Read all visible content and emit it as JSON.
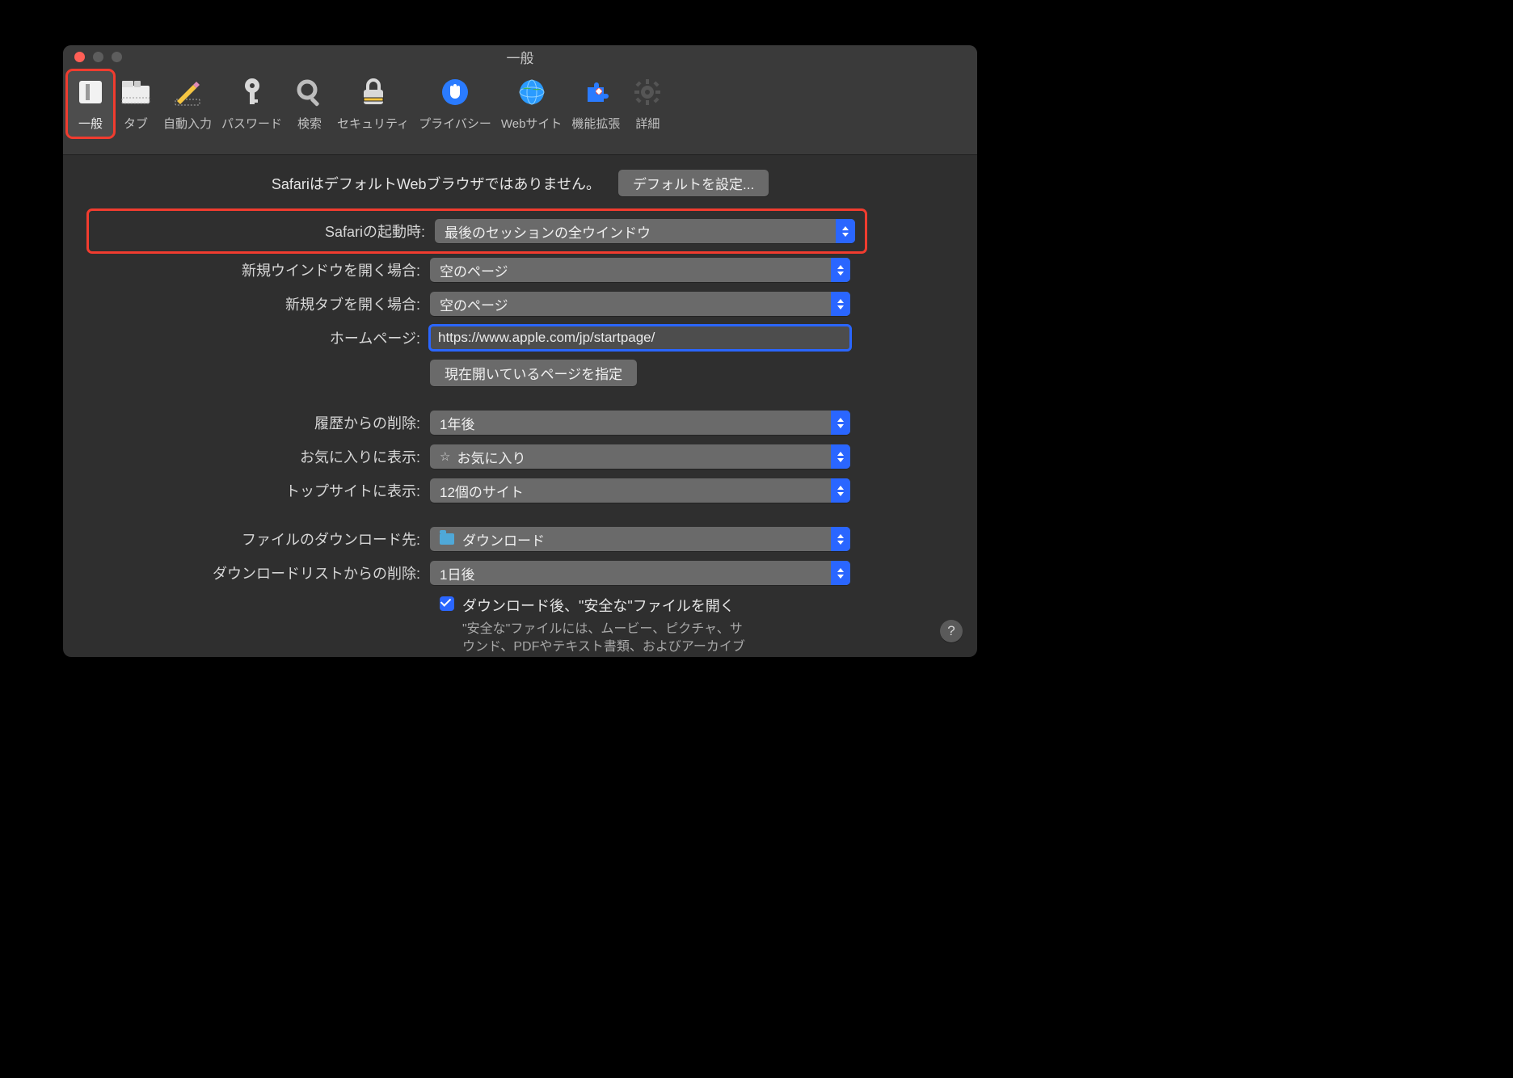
{
  "window": {
    "title": "一般"
  },
  "toolbar": {
    "items": [
      {
        "label": "一般",
        "icon": "switch"
      },
      {
        "label": "タブ",
        "icon": "tabs"
      },
      {
        "label": "自動入力",
        "icon": "pencil"
      },
      {
        "label": "パスワード",
        "icon": "key"
      },
      {
        "label": "検索",
        "icon": "magnify"
      },
      {
        "label": "セキュリティ",
        "icon": "lock"
      },
      {
        "label": "プライバシー",
        "icon": "hand"
      },
      {
        "label": "Webサイト",
        "icon": "globe"
      },
      {
        "label": "機能拡張",
        "icon": "puzzle"
      },
      {
        "label": "詳細",
        "icon": "gear"
      }
    ]
  },
  "banner": {
    "text": "SafariはデフォルトWebブラウザではありません。",
    "button": "デフォルトを設定..."
  },
  "form": {
    "startup": {
      "label": "Safariの起動時:",
      "value": "最後のセッションの全ウインドウ"
    },
    "newWindow": {
      "label": "新規ウインドウを開く場合:",
      "value": "空のページ"
    },
    "newTab": {
      "label": "新規タブを開く場合:",
      "value": "空のページ"
    },
    "homepage": {
      "label": "ホームページ:",
      "value": "https://www.apple.com/jp/startpage/"
    },
    "setCurrent": {
      "button": "現在開いているページを指定"
    },
    "historyDelete": {
      "label": "履歴からの削除:",
      "value": "1年後"
    },
    "favorites": {
      "label": "お気に入りに表示:",
      "value": "お気に入り"
    },
    "topSites": {
      "label": "トップサイトに表示:",
      "value": "12個のサイト"
    },
    "downloadDest": {
      "label": "ファイルのダウンロード先:",
      "value": "ダウンロード"
    },
    "downloadDelete": {
      "label": "ダウンロードリストからの削除:",
      "value": "1日後"
    },
    "safeFiles": {
      "checkbox": "ダウンロード後、\"安全な\"ファイルを開く",
      "hint": "\"安全な\"ファイルには、ムービー、ピクチャ、サウンド、PDFやテキスト書類、およびアーカイブが含まれます。"
    }
  },
  "help": "?"
}
